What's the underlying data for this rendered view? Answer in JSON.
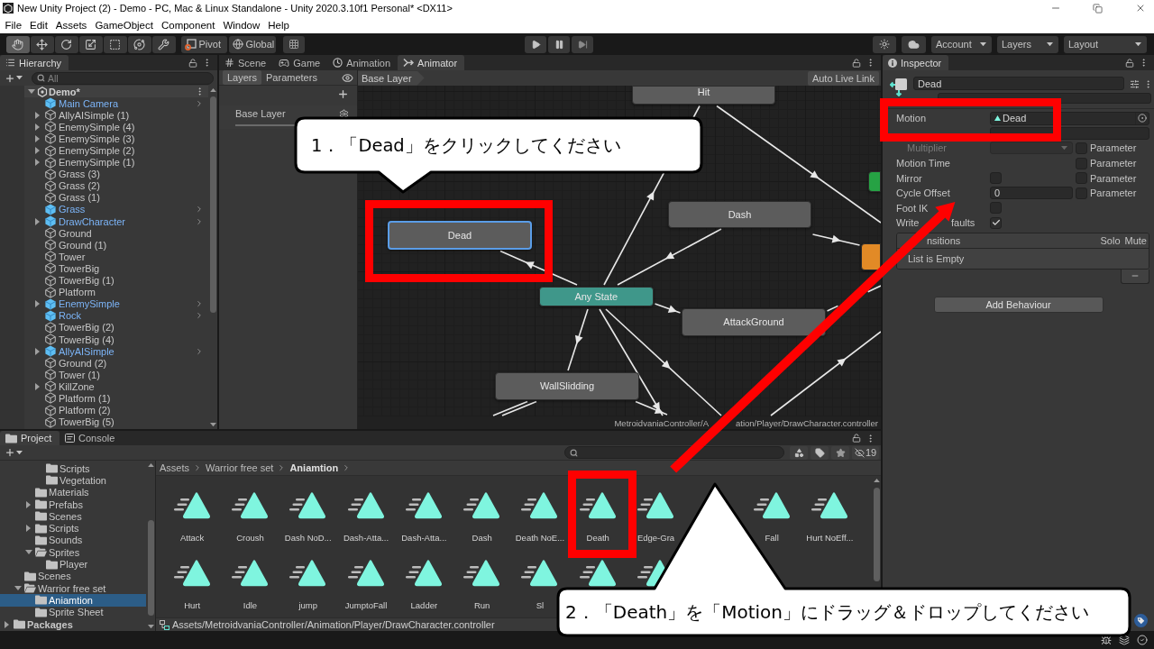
{
  "window": {
    "title": "New Unity Project (2) - Demo - PC, Mac & Linux Standalone - Unity 2020.3.10f1 Personal* <DX11>"
  },
  "menu": [
    "File",
    "Edit",
    "Assets",
    "GameObject",
    "Component",
    "Window",
    "Help"
  ],
  "toolbar": {
    "tools": [
      {
        "kind": "hand",
        "selected": true
      },
      {
        "kind": "move",
        "selected": false
      },
      {
        "kind": "rotate",
        "selected": false
      },
      {
        "kind": "scale",
        "selected": false
      },
      {
        "kind": "rect",
        "selected": false
      },
      {
        "kind": "transform",
        "selected": false
      },
      {
        "kind": "custom",
        "selected": false
      }
    ],
    "pivot": "Pivot",
    "space": "Global",
    "dropdowns": [
      "Account",
      "Layers",
      "Layout"
    ]
  },
  "hierarchy": {
    "title": "Hierarchy",
    "search": {
      "placeholder": "All"
    },
    "scene": {
      "name": "Demo*",
      "expanded": true
    },
    "items": [
      {
        "name": "Main Camera",
        "kind": "prefab"
      },
      {
        "name": "AllyAISimple (1)",
        "kind": "object",
        "expanded": false
      },
      {
        "name": "EnemySimple (4)",
        "kind": "object",
        "expanded": false
      },
      {
        "name": "EnemySimple (3)",
        "kind": "object",
        "expanded": false
      },
      {
        "name": "EnemySimple (2)",
        "kind": "object",
        "expanded": false
      },
      {
        "name": "EnemySimple (1)",
        "kind": "object",
        "expanded": false
      },
      {
        "name": "Grass (3)",
        "kind": "object"
      },
      {
        "name": "Grass (2)",
        "kind": "object"
      },
      {
        "name": "Grass (1)",
        "kind": "object"
      },
      {
        "name": "Grass",
        "kind": "prefab"
      },
      {
        "name": "DrawCharacter",
        "kind": "prefab",
        "expanded": false
      },
      {
        "name": "Ground",
        "kind": "object"
      },
      {
        "name": "Ground (1)",
        "kind": "object"
      },
      {
        "name": "Tower",
        "kind": "object"
      },
      {
        "name": "TowerBig",
        "kind": "object"
      },
      {
        "name": "TowerBig (1)",
        "kind": "object"
      },
      {
        "name": "Platform",
        "kind": "object"
      },
      {
        "name": "EnemySimple",
        "kind": "prefab",
        "expanded": false
      },
      {
        "name": "Rock",
        "kind": "prefab"
      },
      {
        "name": "TowerBig (2)",
        "kind": "object"
      },
      {
        "name": "TowerBig (4)",
        "kind": "object"
      },
      {
        "name": "AllyAISimple",
        "kind": "prefab",
        "expanded": false
      },
      {
        "name": "Ground (2)",
        "kind": "object"
      },
      {
        "name": "Tower (1)",
        "kind": "object"
      },
      {
        "name": "KillZone",
        "kind": "object",
        "expanded": false
      },
      {
        "name": "Platform (1)",
        "kind": "object"
      },
      {
        "name": "Platform (2)",
        "kind": "object"
      },
      {
        "name": "TowerBig (5)",
        "kind": "object"
      }
    ]
  },
  "center_tabs": [
    {
      "label": "Scene",
      "kind": "scene",
      "selected": false
    },
    {
      "label": "Game",
      "kind": "game",
      "selected": false
    },
    {
      "label": "Animation",
      "kind": "animation",
      "selected": false
    },
    {
      "label": "Animator",
      "kind": "animator",
      "selected": true
    }
  ],
  "animator": {
    "side_tabs": [
      {
        "label": "Layers",
        "selected": true
      },
      {
        "label": "Parameters",
        "selected": false
      }
    ],
    "breadcrumb": "Base Layer",
    "live_link": "Auto Live Link",
    "layers": [
      {
        "name": "Base Layer"
      }
    ],
    "states": [
      {
        "name": "Hit",
        "kind": "state",
        "selected": false
      },
      {
        "name": "Dead",
        "kind": "state",
        "selected": true
      },
      {
        "name": "Dash",
        "kind": "state",
        "selected": false
      },
      {
        "name": "Any State",
        "kind": "any",
        "selected": false
      },
      {
        "name": "AttackGround",
        "kind": "state",
        "selected": false
      },
      {
        "name": "WallSlidding",
        "kind": "state",
        "selected": false
      },
      {
        "kind": "entry",
        "selected": false
      },
      {
        "kind": "default",
        "selected": false
      }
    ],
    "path": [
      "MetroidvaniaController/A",
      "ation/Player/DrawCharacter.controller"
    ]
  },
  "inspector": {
    "title": "Inspector",
    "name": "Dead",
    "motion": {
      "label": "Motion",
      "value": "Dead"
    },
    "rows": [
      {
        "kind": "number",
        "disabled": false,
        "children": [
          {
            "kind": "dropdown",
            "label": "Multiplier",
            "disabled": true,
            "parameter": {
              "label": "Parameter",
              "checked": false
            }
          }
        ]
      },
      {
        "kind": "empty",
        "label": "Motion Time",
        "disabled": false,
        "parameter": {
          "label": "Parameter",
          "checked": false
        }
      },
      {
        "kind": "checkbox",
        "label": "Mirror",
        "checked": false,
        "disabled": false,
        "parameter": {
          "label": "Parameter",
          "checked": false
        }
      },
      {
        "kind": "number",
        "label": "Cycle Offset",
        "value": "0",
        "disabled": false,
        "parameter": {
          "label": "Parameter",
          "checked": false
        }
      },
      {
        "kind": "checkbox",
        "label": "Foot IK",
        "checked": false,
        "disabled": false
      },
      {
        "kind": "checkbox",
        "label": [
          "Write",
          "faults"
        ],
        "checked": true,
        "disabled": false
      }
    ],
    "transitions": {
      "title": "nsitions",
      "columns": [
        "Solo",
        "Mute"
      ],
      "empty_text": "List is Empty"
    },
    "add_button": "Add Behaviour"
  },
  "bottom_tabs": [
    {
      "label": "Project",
      "kind": "project",
      "selected": true
    },
    {
      "label": "Console",
      "kind": "console",
      "selected": false
    }
  ],
  "project": {
    "hidden_count": "19",
    "tree": [
      {
        "children": [
          {
            "children": [
              {
                "children": [
                  {
                    "name": "Scripts",
                    "selected": false
                  },
                  {
                    "name": "Vegetation",
                    "selected": false
                  }
                ]
              },
              {
                "name": "Materials",
                "selected": false
              },
              {
                "name": "Prefabs",
                "selected": false,
                "expanded": false
              },
              {
                "name": "Scenes",
                "selected": false
              },
              {
                "name": "Scripts",
                "selected": false,
                "expanded": false
              },
              {
                "name": "Sounds",
                "selected": false
              },
              {
                "name": "Sprites",
                "selected": false,
                "expanded": true,
                "children": [
                  {
                    "name": "Player",
                    "selected": false
                  }
                ]
              }
            ]
          },
          {
            "name": "Scenes",
            "selected": false
          },
          {
            "name": "Warrior free set",
            "selected": false,
            "expanded": true,
            "children": [
              {
                "name": "Aniamtion",
                "selected": true
              },
              {
                "name": "Sprite Sheet",
                "selected": false
              }
            ]
          }
        ]
      },
      {
        "name": "Packages",
        "selected": false,
        "expanded": false
      }
    ],
    "breadcrumb": [
      "Assets",
      "Warrior free set",
      "Aniamtion"
    ],
    "assets": [
      {
        "kind": "clip",
        "label": "Attack"
      },
      {
        "kind": "clip",
        "label": "Croush"
      },
      {
        "kind": "clip",
        "label": "Dash NoD..."
      },
      {
        "kind": "clip",
        "label": "Dash-Atta..."
      },
      {
        "kind": "clip",
        "label": "Dash-Atta..."
      },
      {
        "kind": "clip",
        "label": "Dash"
      },
      {
        "kind": "clip",
        "label": "Death NoE..."
      },
      {
        "kind": "clip",
        "label": "Death"
      },
      {
        "kind": "clip",
        "label": "Edge-Gra"
      },
      {
        "kind": "covered"
      },
      {
        "kind": "clip",
        "label": "Fall"
      },
      {
        "kind": "clip",
        "label": "Hurt NoEff..."
      },
      {
        "kind": "clip",
        "label": "Hurt"
      },
      {
        "kind": "clip",
        "label": "Idle"
      },
      {
        "kind": "clip",
        "label": "jump"
      },
      {
        "kind": "clip",
        "label": "JumptoFall"
      },
      {
        "kind": "clip",
        "label": "Ladder"
      },
      {
        "kind": "clip",
        "label": "Run"
      },
      {
        "kind": "clip",
        "label": "Sl"
      },
      {
        "kind": "clip"
      },
      {
        "kind": "clip"
      }
    ],
    "path": "Assets/MetroidvaniaController/Animation/Player/DrawCharacter.controller"
  },
  "annotations": [
    {
      "kind": "callout",
      "text": "1．「Dead」をクリックしてください"
    },
    {
      "kind": "callout",
      "text": "2．「Death」を「Motion」にドラッグ＆ドロップしてください"
    }
  ]
}
